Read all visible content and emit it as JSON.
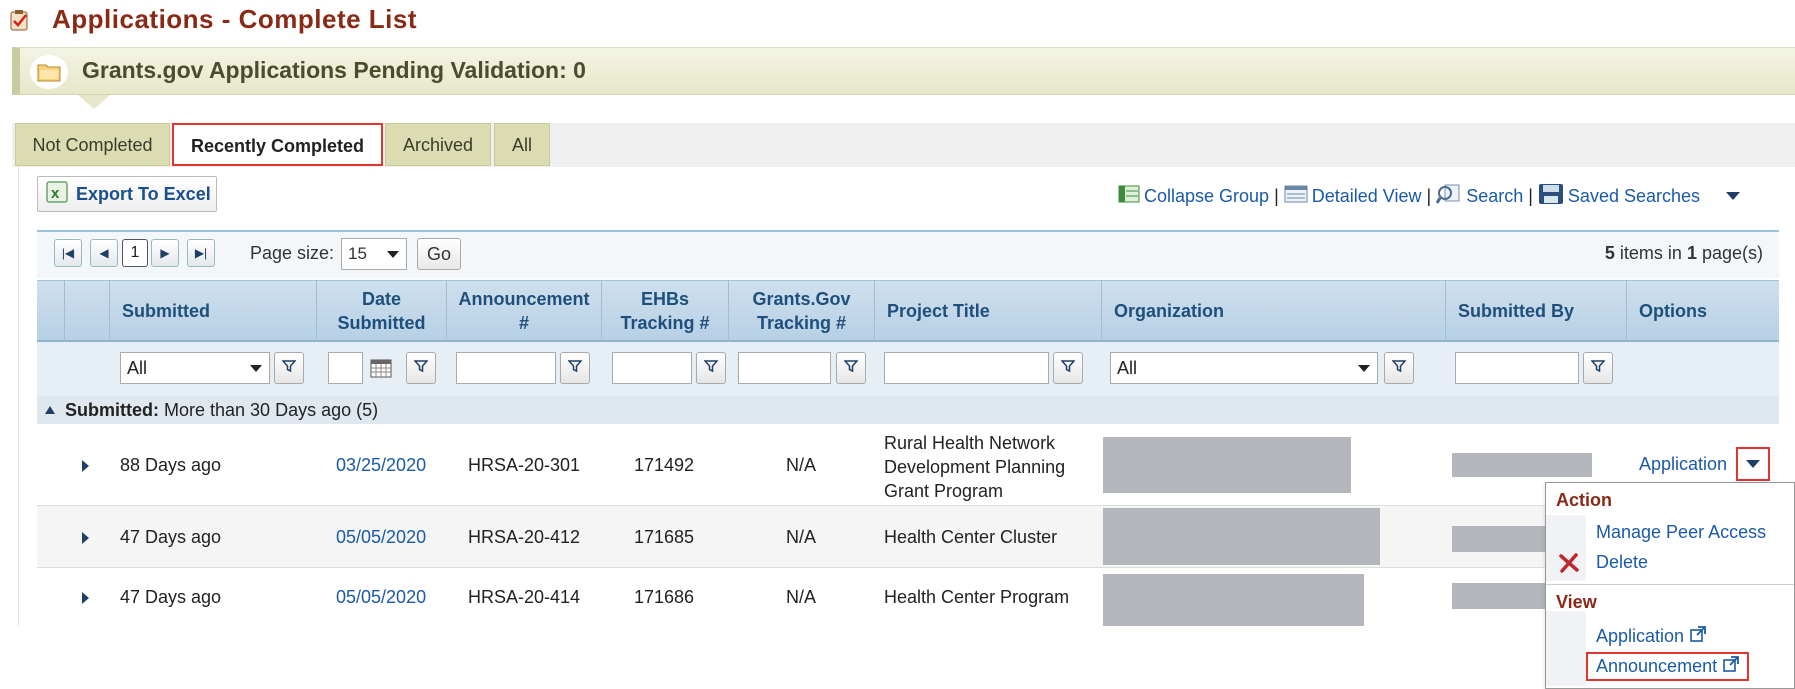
{
  "page": {
    "title": "Applications - Complete List"
  },
  "banner": {
    "text": "Grants.gov Applications Pending Validation: 0"
  },
  "tabs": [
    {
      "label": "Not Completed"
    },
    {
      "label": "Recently Completed"
    },
    {
      "label": "Archived"
    },
    {
      "label": "All"
    }
  ],
  "toolbar": {
    "export_label": "Export To Excel",
    "collapse_group": "Collapse Group",
    "detailed_view": "Detailed View",
    "search": "Search",
    "saved_searches": "Saved Searches"
  },
  "pager": {
    "current_page": "1",
    "page_size_label": "Page size:",
    "page_size_value": "15",
    "go_label": "Go",
    "items_count": "5",
    "items_mid": " items in ",
    "pages_count": "1",
    "pages_suffix": " page(s)"
  },
  "columns": {
    "submitted": "Submitted",
    "date_submitted_1": "Date",
    "date_submitted_2": "Submitted",
    "announcement_1": "Announcement",
    "announcement_2": "#",
    "ehbs_1": "EHBs",
    "ehbs_2": "Tracking #",
    "grants_1": "Grants.Gov",
    "grants_2": "Tracking #",
    "project_title": "Project Title",
    "organization": "Organization",
    "submitted_by": "Submitted By",
    "options": "Options"
  },
  "filters": {
    "submitted_value": "All",
    "organization_value": "All"
  },
  "group": {
    "label": "Submitted:",
    "value": " More than 30 Days ago (5)"
  },
  "rows": [
    {
      "submitted": "88 Days ago",
      "date": "03/25/2020",
      "announcement": "HRSA-20-301",
      "ehbs": "171492",
      "grants": "N/A",
      "title_1": "Rural Health Network",
      "title_2": "Development Planning",
      "title_3": "Grant Program"
    },
    {
      "submitted": "47 Days ago",
      "date": "05/05/2020",
      "announcement": "HRSA-20-412",
      "ehbs": "171685",
      "grants": "N/A",
      "title": "Health Center Cluster"
    },
    {
      "submitted": "47 Days ago",
      "date": "05/05/2020",
      "announcement": "HRSA-20-414",
      "ehbs": "171686",
      "grants": "N/A",
      "title": "Health Center Program"
    }
  ],
  "options": {
    "application_link": "Application"
  },
  "menu": {
    "action_header": "Action",
    "manage_peer_access": "Manage Peer Access",
    "delete": "Delete",
    "view_header": "View",
    "application": "Application",
    "announcement": "Announcement"
  },
  "colors": {
    "title": "#8a2a16",
    "link": "#1a5aa8",
    "highlight": "#e0362f",
    "tab": "#dcdcb2",
    "header": "#b7d0e5"
  }
}
